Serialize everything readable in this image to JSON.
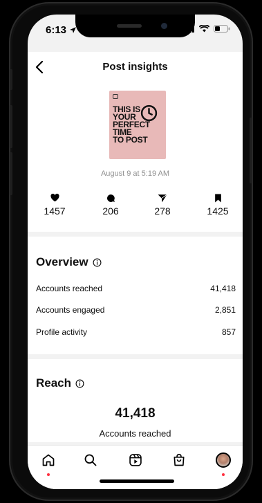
{
  "status": {
    "time": "6:13"
  },
  "header": {
    "title": "Post insights"
  },
  "post": {
    "thumbnail_text": [
      "THIS IS",
      "YOUR",
      "PERFECT TIME",
      "TO POST"
    ],
    "date": "August 9 at 5:19 AM"
  },
  "metrics": [
    {
      "icon": "heart-icon",
      "value": "1457"
    },
    {
      "icon": "comment-icon",
      "value": "206"
    },
    {
      "icon": "share-icon",
      "value": "278"
    },
    {
      "icon": "bookmark-icon",
      "value": "1425"
    }
  ],
  "overview": {
    "title": "Overview",
    "rows": [
      {
        "label": "Accounts reached",
        "value": "41,418"
      },
      {
        "label": "Accounts engaged",
        "value": "2,851"
      },
      {
        "label": "Profile activity",
        "value": "857"
      }
    ]
  },
  "reach": {
    "title": "Reach",
    "number": "41,418",
    "label": "Accounts reached"
  },
  "nav": {
    "items": [
      "home-icon",
      "search-icon",
      "reels-icon",
      "shop-icon",
      "profile-avatar"
    ]
  },
  "colors": {
    "accent": "#ff3040",
    "thumbnail_bg": "#e8b9b8"
  }
}
